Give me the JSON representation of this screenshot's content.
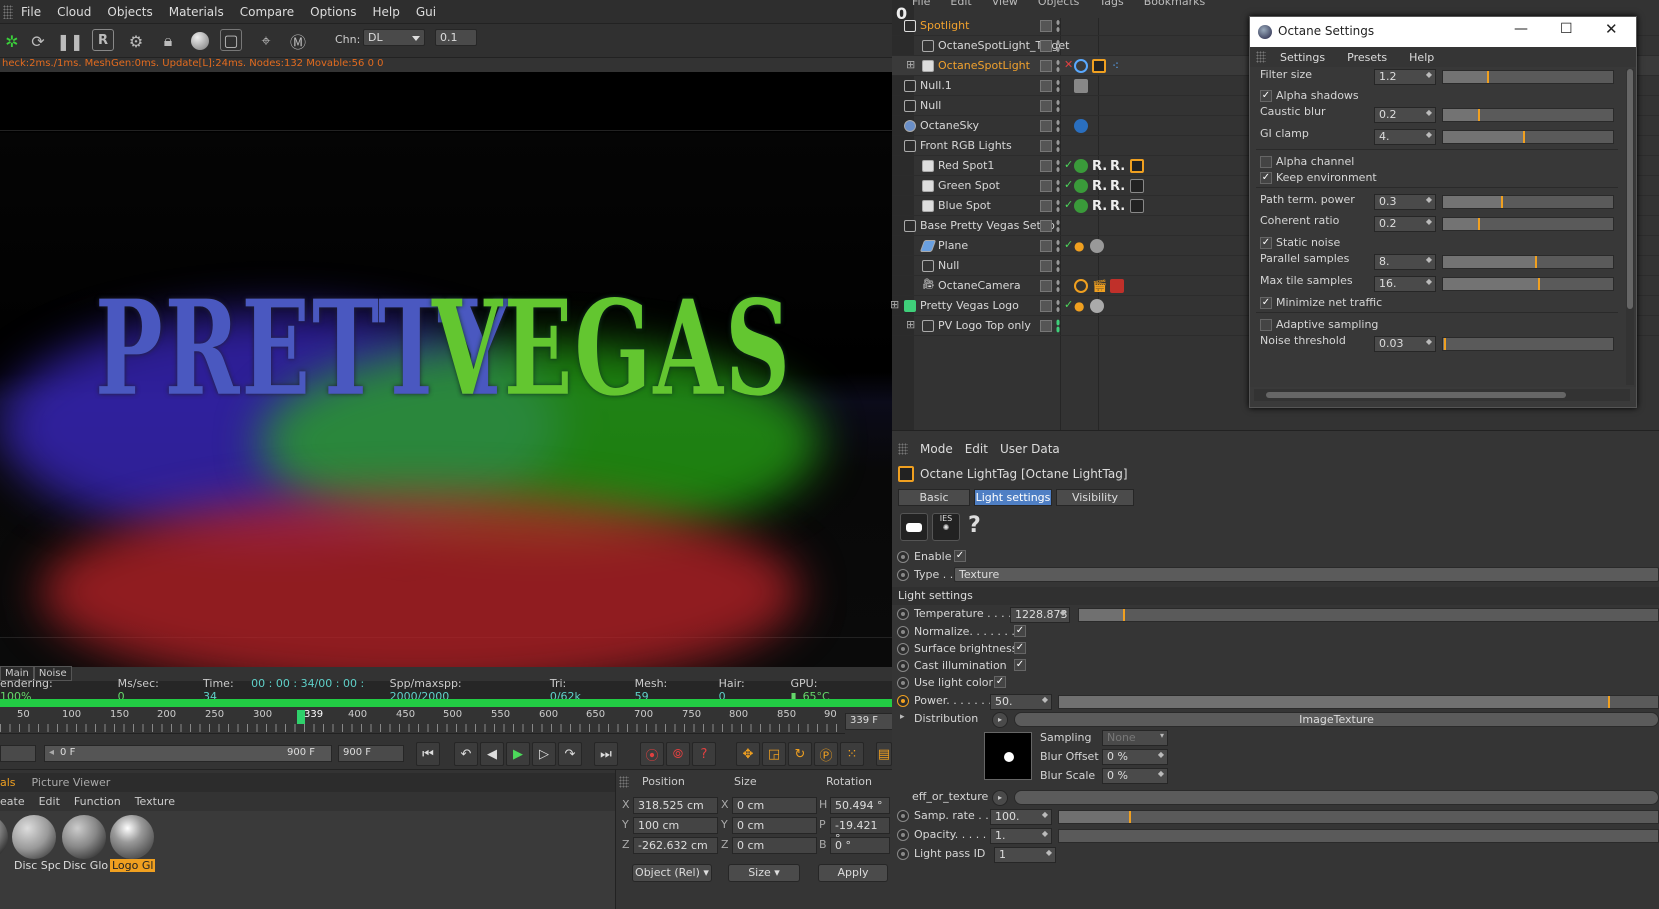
{
  "app": {
    "menu": [
      "File",
      "Cloud",
      "Objects",
      "Materials",
      "Compare",
      "Options",
      "Help",
      "Gui"
    ],
    "chn_label": "Chn:",
    "chn_value": "DL",
    "chn_step": "0.1",
    "stats": "heck:2ms./1ms. MeshGen:0ms. Update[L]:24ms. Nodes:132 Movable:56  0 0",
    "render_logo": [
      "PRETTY",
      "VEGAS"
    ],
    "render_tabs": [
      "Main",
      "Noise"
    ],
    "status": {
      "rendering_label": "endering:",
      "rendering_value": "100%",
      "mssec_label": "Ms/sec:",
      "mssec_value": "0",
      "time_label": "Time:",
      "time_value": "00 : 00 : 34/00 : 00 : 34",
      "spp_label": "Spp/maxspp:",
      "spp_value": "2000/2000",
      "tri_label": "Tri:",
      "tri_value": "0/62k",
      "mesh_label": "Mesh:",
      "mesh_value": "59",
      "hair_label": "Hair:",
      "hair_value": "0",
      "gpu_label": "GPU:",
      "gpu_temp": "65°C"
    },
    "progress": 1.0,
    "timeline": {
      "ticks": [
        "50",
        "100",
        "150",
        "200",
        "250",
        "300",
        "339",
        "400",
        "450",
        "500",
        "550",
        "600",
        "650",
        "700",
        "750",
        "800",
        "850",
        "90"
      ],
      "current_frame_field": "339 F",
      "range_start": "0 F",
      "range_end": "900 F",
      "max_frame": "900 F"
    }
  },
  "materials": {
    "tabs": [
      "als",
      "Picture Viewer"
    ],
    "menu": [
      "eate",
      "Edit",
      "Function",
      "Texture"
    ],
    "items": [
      "Disc Spc",
      "Disc Glo",
      "Logo Gl"
    ]
  },
  "coords": {
    "headers": [
      "Position",
      "Size",
      "Rotation"
    ],
    "pos": [
      {
        "axis": "X",
        "value": "318.525 cm"
      },
      {
        "axis": "Y",
        "value": "100 cm"
      },
      {
        "axis": "Z",
        "value": "-262.632 cm"
      }
    ],
    "size": [
      {
        "axis": "X",
        "value": "0 cm"
      },
      {
        "axis": "Y",
        "value": "0 cm"
      },
      {
        "axis": "Z",
        "value": "0 cm"
      }
    ],
    "rot": [
      {
        "axis": "H",
        "value": "50.494 °"
      },
      {
        "axis": "P",
        "value": "-19.421 °"
      },
      {
        "axis": "B",
        "value": "0 °"
      }
    ],
    "mode": "Object (Rel)",
    "size_mode": "Size",
    "apply": "Apply"
  },
  "objm": {
    "topbar": [
      "File",
      "Edit",
      "View",
      "Objects",
      "Tags",
      "Bookmarks"
    ],
    "side_label": "0",
    "rows": [
      {
        "name": "Spotlight",
        "selected": true
      },
      {
        "name": "OctaneSpotLight_Target",
        "selected": false
      },
      {
        "name": "OctaneSpotLight",
        "selected": true
      },
      {
        "name": "Null.1",
        "selected": false
      },
      {
        "name": "Null",
        "selected": false
      },
      {
        "name": "OctaneSky",
        "selected": false
      },
      {
        "name": "Front RGB Lights",
        "selected": false
      },
      {
        "name": "Red Spot1",
        "selected": false
      },
      {
        "name": "Green Spot",
        "selected": false
      },
      {
        "name": "Blue Spot",
        "selected": false
      },
      {
        "name": "Base Pretty Vegas Setup",
        "selected": false
      },
      {
        "name": "Plane",
        "selected": false
      },
      {
        "name": "Null",
        "selected": false
      },
      {
        "name": "OctaneCamera",
        "selected": false
      },
      {
        "name": "Pretty Vegas Logo",
        "selected": false
      },
      {
        "name": "PV Logo Top only",
        "selected": false
      }
    ]
  },
  "octane": {
    "title": "Octane Settings",
    "menu": [
      "Settings",
      "Presets",
      "Help"
    ],
    "filter_size_label": "Filter size",
    "filter_size": "1.2",
    "alpha_shadows": "Alpha shadows",
    "caustic_blur_label": "Caustic blur",
    "caustic_blur": "0.2",
    "gi_clamp_label": "GI clamp",
    "gi_clamp": "4.",
    "alpha_channel": "Alpha channel",
    "keep_environment": "Keep environment",
    "path_term_label": "Path term. power",
    "path_term": "0.3",
    "coherent_label": "Coherent ratio",
    "coherent": "0.2",
    "static_noise": "Static noise",
    "parallel_label": "Parallel samples",
    "parallel": "8.",
    "max_tile_label": "Max tile samples",
    "max_tile": "16.",
    "minimize_net": "Minimize net traffic",
    "adaptive": "Adaptive sampling",
    "noise_thr_label": "Noise threshold",
    "noise_thr": "0.03",
    "sliders": {
      "filter_size": 0.27,
      "caustic_blur": 0.22,
      "gi_clamp": 0.48,
      "path_term": 0.35,
      "coherent": 0.22,
      "parallel": 0.55,
      "max_tile": 0.57,
      "noise_thr": 0.02
    }
  },
  "attr": {
    "menu": [
      "Mode",
      "Edit",
      "User Data"
    ],
    "tag_title": "Octane LightTag [Octane LightTag]",
    "tabs": [
      "Basic",
      "Light settings",
      "Visibility"
    ],
    "enable": "Enable",
    "type_label": "Type . .",
    "type_value": "Texture",
    "section": "Light settings",
    "temperature_label": "Temperature . . . . .",
    "temperature": "1228.873",
    "normalize": "Normalize. . . . . . . .",
    "surface_brightness": "Surface brightness",
    "cast_illumination": "Cast illumination",
    "use_light_color": "Use light color",
    "power_label": "Power. . . . . . .",
    "power": "50.",
    "distribution_label": "Distribution",
    "distribution_value": "ImageTexture",
    "sampling_label": "Sampling",
    "sampling_value": "None",
    "blur_offset_label": "Blur Offset",
    "blur_offset": "0 %",
    "blur_scale_label": "Blur Scale",
    "blur_scale": "0 %",
    "eff_label": "eff_or_texture",
    "samp_rate_label": "Samp. rate . . .",
    "samp_rate": "100.",
    "opacity_label": "Opacity. . . . . .",
    "opacity": "1.",
    "light_pass_label": "Light pass ID",
    "light_pass": "1",
    "sliders": {
      "temperature": 0.08,
      "power": 0.92,
      "samp_rate": 0.12
    },
    "help_glyph": "?"
  },
  "colors": {
    "accent_orange": "#f0a020",
    "selection_blue": "#4f7fc4",
    "progress_green": "#22cc44"
  }
}
